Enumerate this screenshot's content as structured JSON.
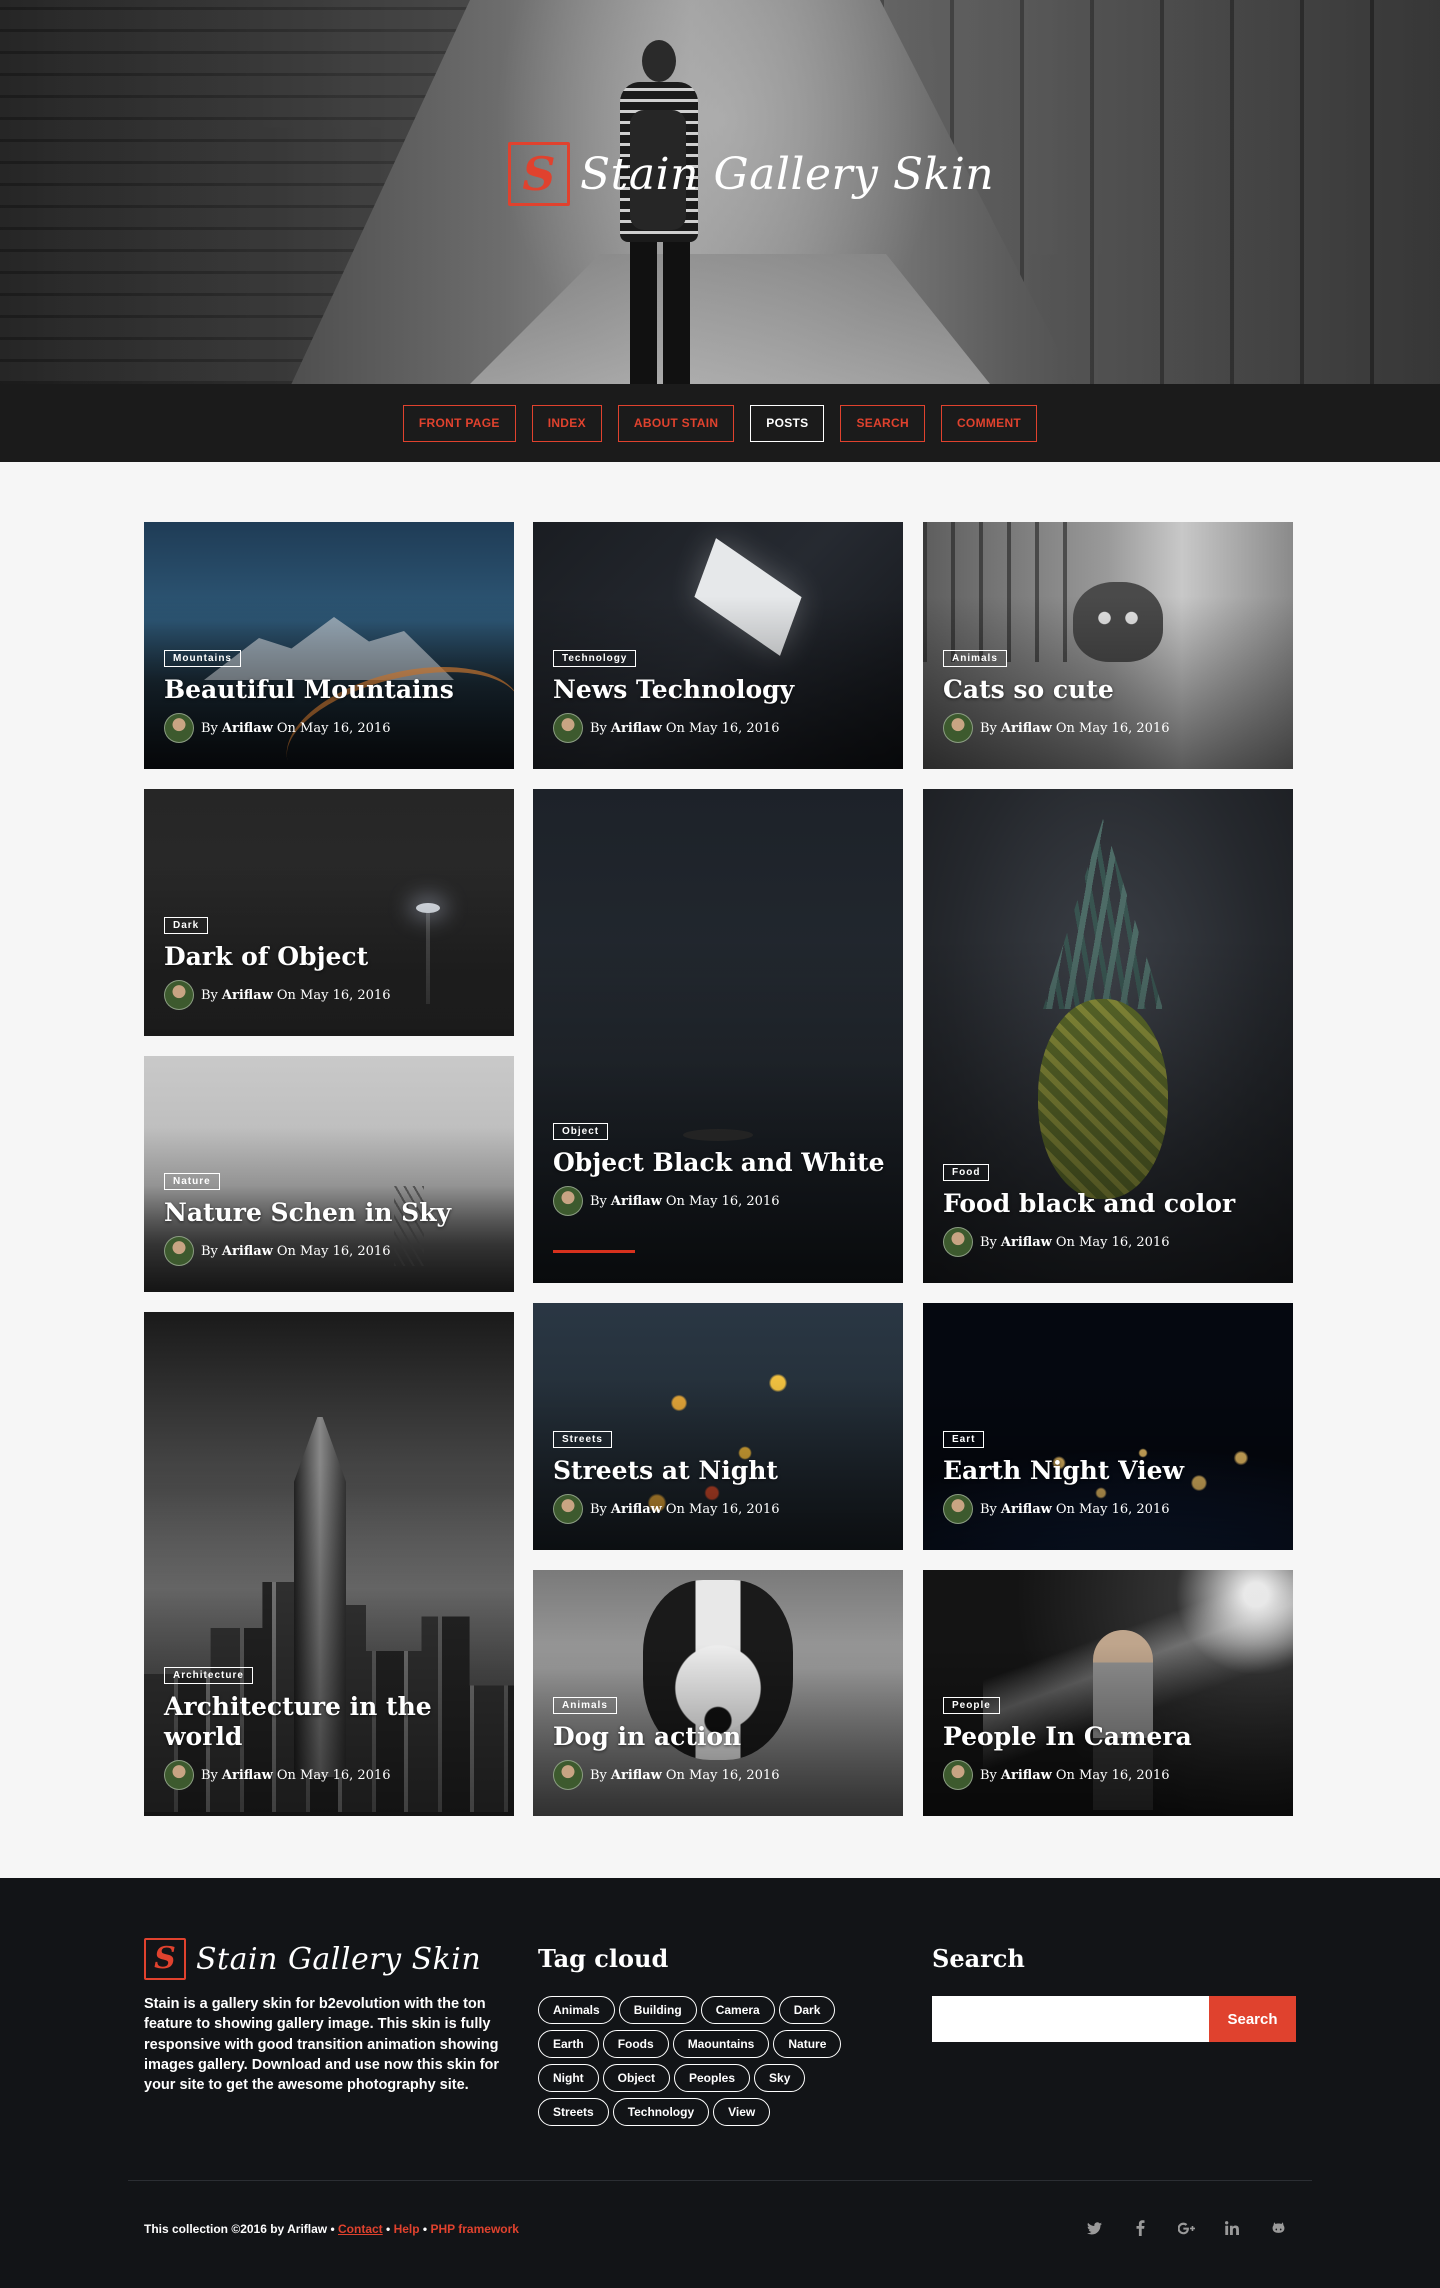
{
  "site": {
    "logo_letter": "S",
    "title": "Stain Gallery Skin"
  },
  "nav": [
    {
      "label": "FRONT PAGE",
      "active": false
    },
    {
      "label": "INDEX",
      "active": false
    },
    {
      "label": "ABOUT STAIN",
      "active": false
    },
    {
      "label": "POSTS",
      "active": true
    },
    {
      "label": "SEARCH",
      "active": false
    },
    {
      "label": "COMMENT",
      "active": false
    }
  ],
  "byline": {
    "by": "By",
    "author": "Ariflaw",
    "on": "On",
    "date": "May 16, 2016"
  },
  "posts": [
    {
      "tag": "Mountains",
      "title": "Beautiful Mountains"
    },
    {
      "tag": "Technology",
      "title": "News Technology"
    },
    {
      "tag": "Animals",
      "title": "Cats so cute"
    },
    {
      "tag": "Dark",
      "title": "Dark of Object"
    },
    {
      "tag": "Object",
      "title": "Object Black and White"
    },
    {
      "tag": "Food",
      "title": "Food black and color"
    },
    {
      "tag": "Nature",
      "title": "Nature Schen in Sky"
    },
    {
      "tag": "Architecture",
      "title": "Architecture in the world"
    },
    {
      "tag": "Streets",
      "title": "Streets at Night"
    },
    {
      "tag": "Eart",
      "title": "Earth Night View"
    },
    {
      "tag": "Animals",
      "title": "Dog in action"
    },
    {
      "tag": "People",
      "title": "People In Camera"
    }
  ],
  "footer": {
    "logo_letter": "S",
    "title": "Stain Gallery Skin",
    "about": "Stain is a gallery skin for b2evolution with the ton feature to showing gallery image. This skin is fully responsive with good transition animation showing images gallery. Download and use now this skin for your site to get the awesome photography site.",
    "tag_cloud_heading": "Tag cloud",
    "tags": [
      "Animals",
      "Building",
      "Camera",
      "Dark",
      "Earth",
      "Foods",
      "Maountains",
      "Nature",
      "Night",
      "Object",
      "Peoples",
      "Sky",
      "Streets",
      "Technology",
      "View"
    ],
    "search_heading": "Search",
    "search_value": "",
    "search_button": "Search",
    "copyright_text": "This collection ©2016 by Ariflaw •",
    "contact_link": "Contact",
    "sep1": "•",
    "help_link": "Help",
    "sep2": "•",
    "framework_link": "PHP framework",
    "socials": [
      "twitter-icon",
      "facebook-icon",
      "google-plus-icon",
      "linkedin-icon",
      "github-icon"
    ]
  },
  "colors": {
    "accent": "#e0422e",
    "nav_bg": "#1b1b1b",
    "footer_bg": "#121417",
    "page_bg": "#f6f6f6"
  }
}
